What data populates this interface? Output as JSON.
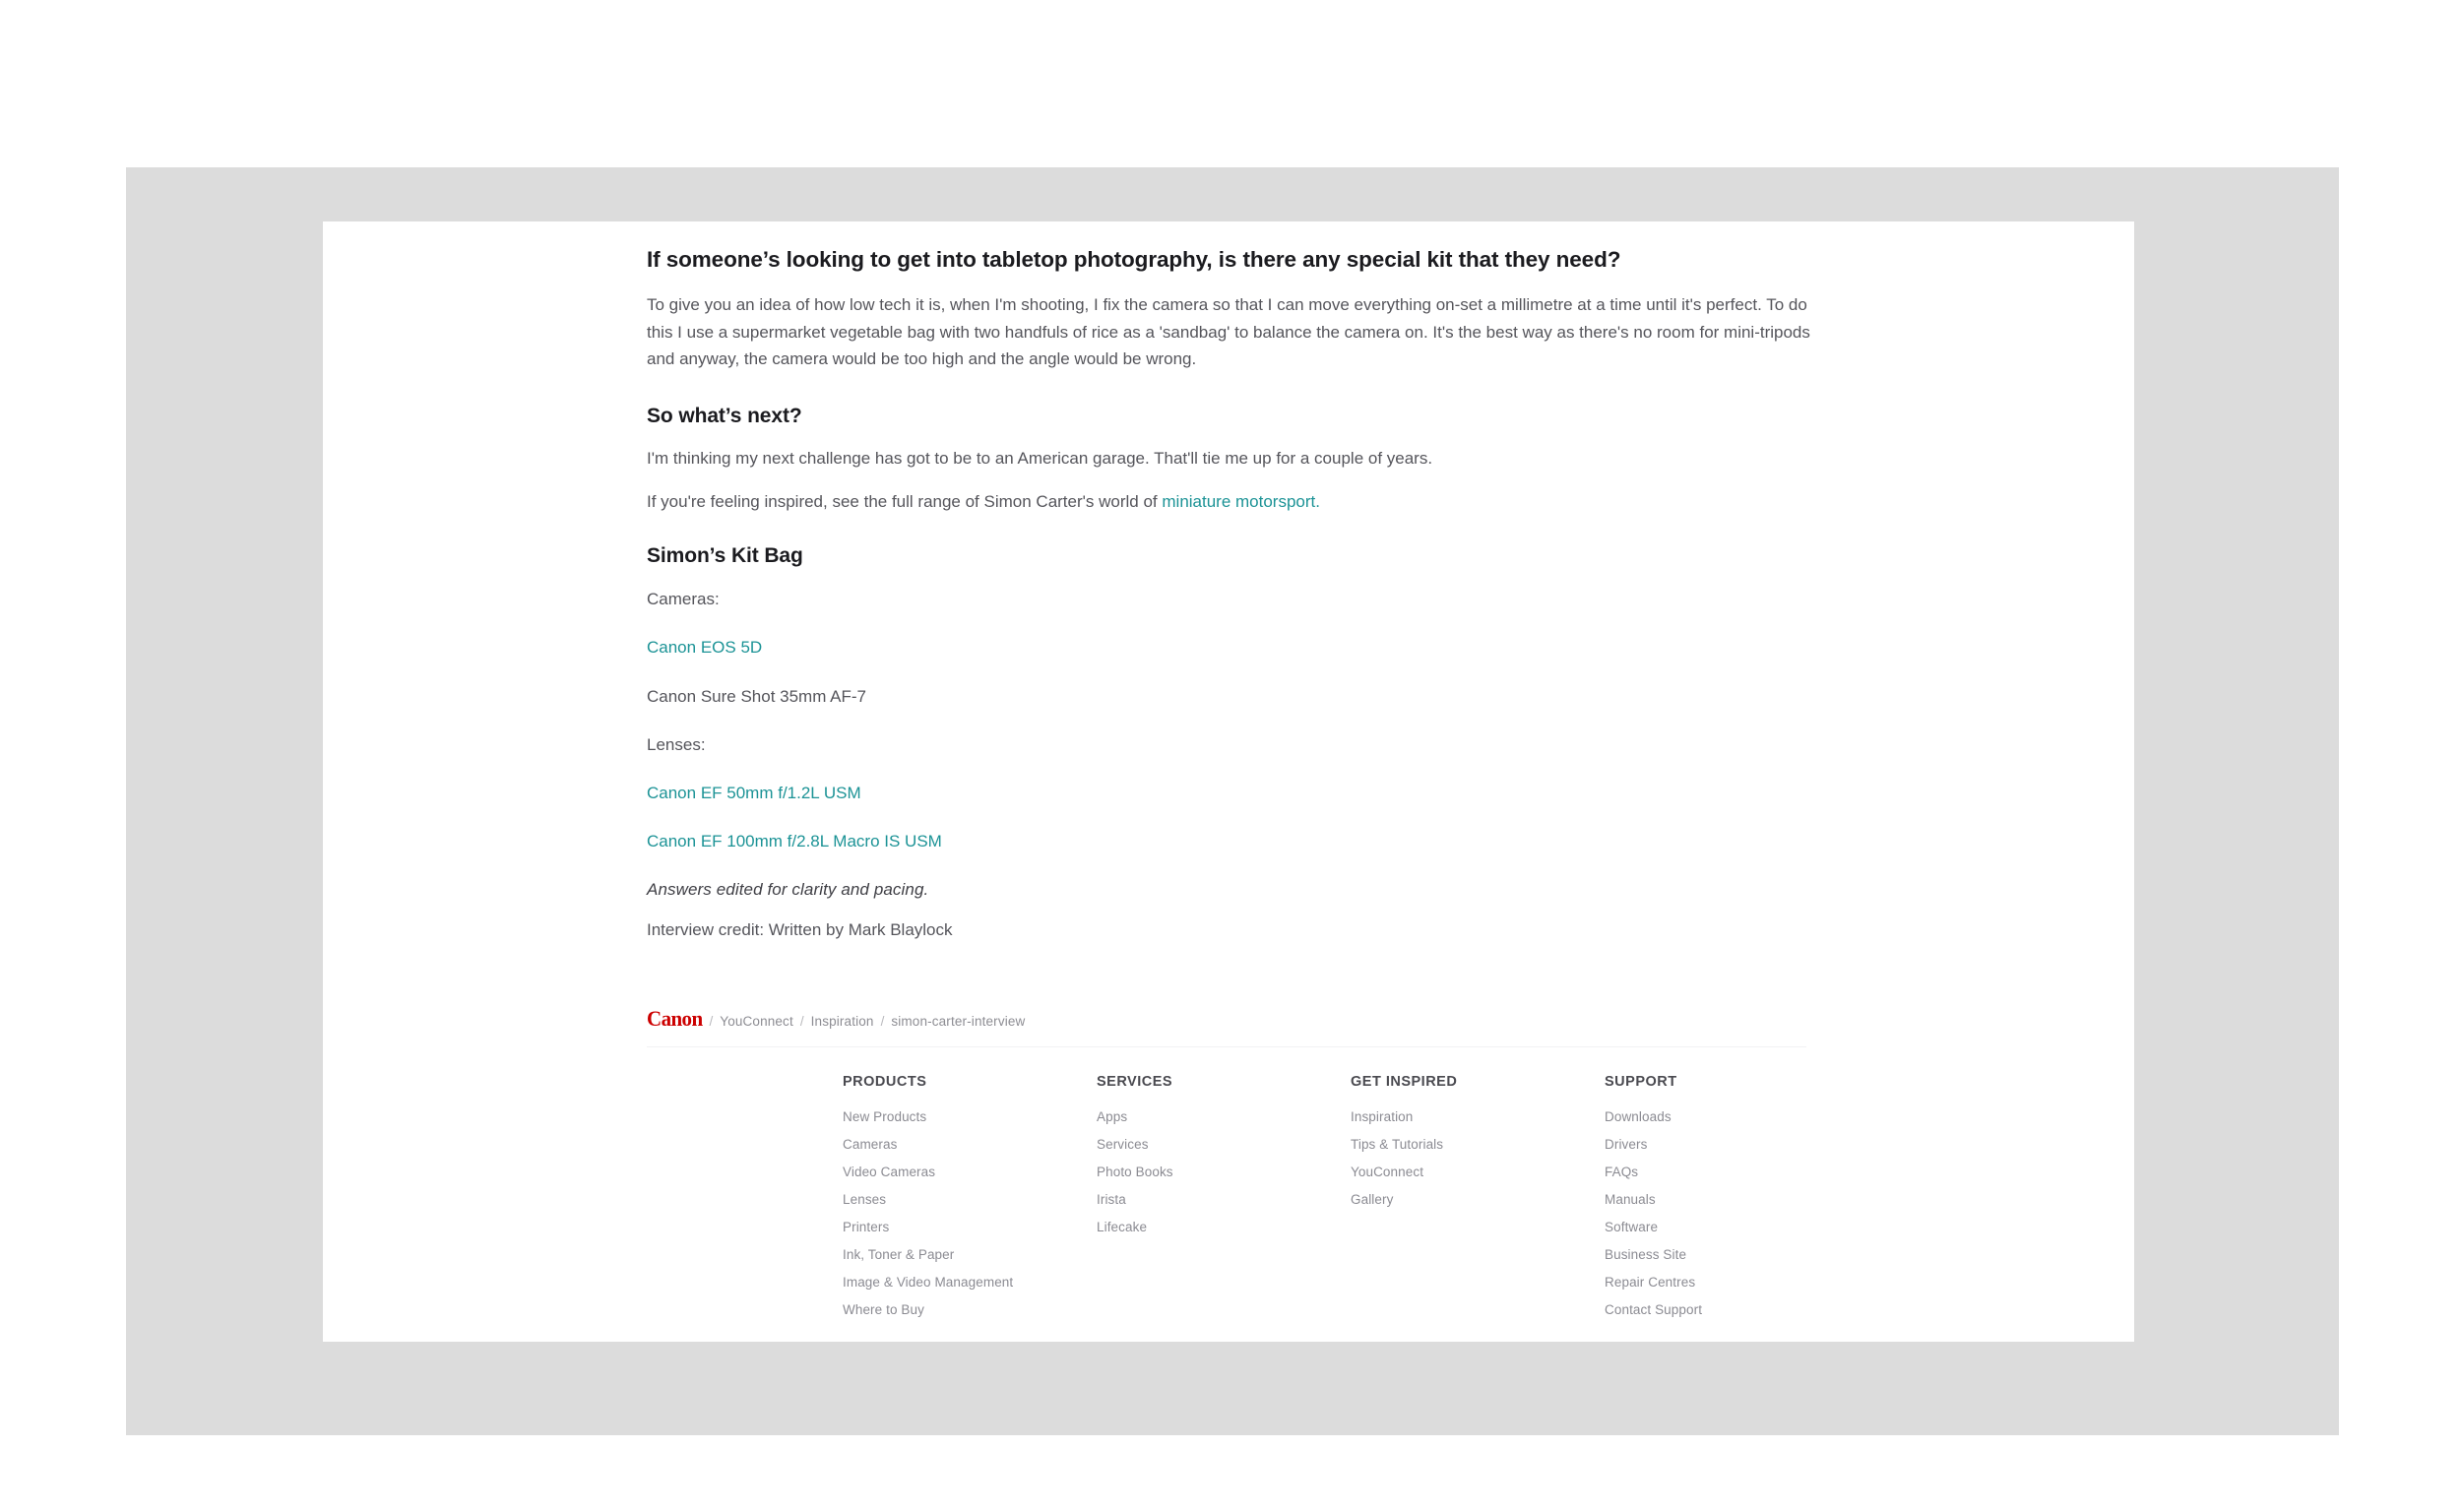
{
  "article": {
    "question_heading": "If someone’s looking to get into tabletop photography, is there any special kit that they need?",
    "answer_paragraph": "To give you an idea of how low tech it is, when I'm shooting, I fix the camera so that I can move everything on-set a millimetre at a time until it's perfect. To do this I use a supermarket vegetable bag with two handfuls of rice as a 'sandbag' to balance the camera on. It's the best way as there's no room for mini-tripods and anyway, the camera would be too high and the angle would be wrong.",
    "next_heading": "So what’s next?",
    "next_paragraph": "I'm thinking my next challenge has got to be to an American garage. That'll tie me up for a couple of years.",
    "inspired_prefix": "If you're feeling inspired, see the full range of Simon Carter's world of ",
    "inspired_link": "miniature motorsport.",
    "kit_heading": "Simon’s Kit Bag",
    "cameras_label": "Cameras:",
    "cameras": [
      {
        "name": "Canon EOS 5D",
        "is_link": true
      },
      {
        "name": "Canon Sure Shot 35mm AF-7",
        "is_link": false
      }
    ],
    "lenses_label": "Lenses:",
    "lenses": [
      {
        "name": "Canon EF 50mm f/1.2L USM",
        "is_link": true
      },
      {
        "name": "Canon EF 100mm f/2.8L Macro IS USM",
        "is_link": true
      }
    ],
    "editorial_note": "Answers edited for clarity and pacing.",
    "credit": "Interview credit: Written by Mark Blaylock"
  },
  "breadcrumb": {
    "logo_text": "Canon",
    "separator": "/",
    "items": [
      "YouConnect",
      "Inspiration",
      "simon-carter-interview"
    ]
  },
  "footer": {
    "columns": [
      {
        "title": "PRODUCTS",
        "links": [
          "New Products",
          "Cameras",
          "Video Cameras",
          "Lenses",
          "Printers",
          "Ink, Toner & Paper",
          "Image & Video Management",
          "Where to Buy"
        ]
      },
      {
        "title": "SERVICES",
        "links": [
          "Apps",
          "Services",
          "Photo Books",
          "Irista",
          "Lifecake"
        ]
      },
      {
        "title": "GET INSPIRED",
        "links": [
          "Inspiration",
          "Tips & Tutorials",
          "YouConnect",
          "Gallery"
        ]
      },
      {
        "title": "SUPPORT",
        "links": [
          "Downloads",
          "Drivers",
          "FAQs",
          "Manuals",
          "Software",
          "Business Site",
          "Repair Centres",
          "Contact Support"
        ]
      }
    ]
  },
  "colors": {
    "link_teal": "#1c9396",
    "canon_red": "#cc0000",
    "body_text": "#55555b",
    "heading": "#1b1b1f",
    "plate_gray": "#dcdcdc",
    "page_white": "#ffffff",
    "footer_title": "#4a4a50",
    "footer_link": "#8b8b92"
  }
}
